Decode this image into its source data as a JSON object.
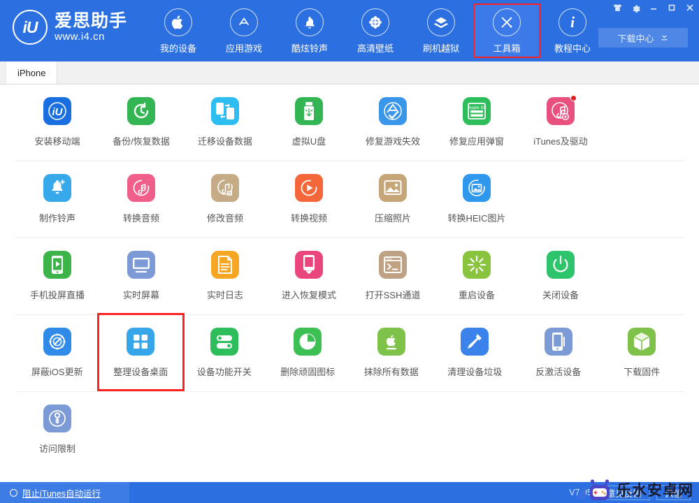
{
  "window": {
    "controls": [
      {
        "name": "skin-icon",
        "label": "换肤"
      },
      {
        "name": "settings-icon",
        "label": "设置"
      },
      {
        "name": "minimize-icon",
        "label": "最小化"
      },
      {
        "name": "maximize-icon",
        "label": "最大化"
      },
      {
        "name": "close-icon",
        "label": "关闭"
      }
    ]
  },
  "brand": {
    "logo_text": "iU",
    "name_cn": "爱思助手",
    "url": "www.i4.cn"
  },
  "header": {
    "nav": [
      {
        "label": "我的设备",
        "icon": "apple-icon",
        "active": false,
        "highlight": false
      },
      {
        "label": "应用游戏",
        "icon": "appstore-icon",
        "active": false,
        "highlight": false
      },
      {
        "label": "酷炫铃声",
        "icon": "bell-icon",
        "active": false,
        "highlight": false
      },
      {
        "label": "高清壁纸",
        "icon": "flower-icon",
        "active": false,
        "highlight": false
      },
      {
        "label": "刷机越狱",
        "icon": "box-icon",
        "active": false,
        "highlight": false
      },
      {
        "label": "工具箱",
        "icon": "tools-icon",
        "active": true,
        "highlight": true
      },
      {
        "label": "教程中心",
        "icon": "info-icon",
        "active": false,
        "highlight": false
      }
    ],
    "download_center": {
      "label": "下载中心",
      "icon": "download-icon"
    }
  },
  "tabs": [
    {
      "label": "iPhone",
      "active": true
    }
  ],
  "tools": {
    "rows": [
      [
        {
          "label": "安装移动端",
          "icon": "i4-app-icon",
          "color": "#1a6fe0",
          "badge": false
        },
        {
          "label": "备份/恢复数据",
          "icon": "backup-restore-icon",
          "color": "#34b554",
          "badge": false
        },
        {
          "label": "迁移设备数据",
          "icon": "migrate-data-icon",
          "color": "#2ebdf0",
          "badge": false
        },
        {
          "label": "虚拟U盘",
          "icon": "usb-drive-icon",
          "color": "#34b554",
          "badge": false
        },
        {
          "label": "修复游戏失效",
          "icon": "fix-game-icon",
          "color": "#3a96e8",
          "badge": false
        },
        {
          "label": "修复应用弹窗",
          "icon": "apple-id-icon",
          "color": "#2dbd5a",
          "badge": false
        },
        {
          "label": "iTunes及驱动",
          "icon": "itunes-driver-icon",
          "color": "#e8517e",
          "badge": true
        }
      ],
      [
        {
          "label": "制作铃声",
          "icon": "make-ringtone-icon",
          "color": "#37a8ea",
          "badge": false
        },
        {
          "label": "转换音频",
          "icon": "convert-audio-icon",
          "color": "#ef5f8a",
          "badge": false
        },
        {
          "label": "修改音频",
          "icon": "edit-audio-icon",
          "color": "#c6ab87",
          "badge": false
        },
        {
          "label": "转换视频",
          "icon": "convert-video-icon",
          "color": "#f4673a",
          "badge": false
        },
        {
          "label": "压缩照片",
          "icon": "compress-photo-icon",
          "color": "#c6a678",
          "badge": false
        },
        {
          "label": "转换HEIC图片",
          "icon": "heic-convert-icon",
          "color": "#2f97ec",
          "badge": false
        }
      ],
      [
        {
          "label": "手机投屏直播",
          "icon": "screen-cast-icon",
          "color": "#3cb44a",
          "badge": false
        },
        {
          "label": "实时屏幕",
          "icon": "live-screen-icon",
          "color": "#7b9ad6",
          "badge": false
        },
        {
          "label": "实时日志",
          "icon": "live-log-icon",
          "color": "#f5a623",
          "badge": false
        },
        {
          "label": "进入恢复模式",
          "icon": "recovery-mode-icon",
          "color": "#e8467c",
          "badge": false
        },
        {
          "label": "打开SSH通道",
          "icon": "ssh-tunnel-icon",
          "color": "#bfa183",
          "badge": false
        },
        {
          "label": "重启设备",
          "icon": "reboot-device-icon",
          "color": "#8ac43f",
          "badge": false
        },
        {
          "label": "关闭设备",
          "icon": "shutdown-device-icon",
          "color": "#2ec46b",
          "badge": false
        }
      ],
      [
        {
          "label": "屏蔽iOS更新",
          "icon": "block-ios-update-icon",
          "color": "#2f8ae8",
          "badge": false
        },
        {
          "label": "整理设备桌面",
          "icon": "organize-desktop-icon",
          "color": "#36a5ea",
          "badge": false,
          "highlight": true
        },
        {
          "label": "设备功能开关",
          "icon": "feature-toggle-icon",
          "color": "#2dbd5a",
          "badge": false
        },
        {
          "label": "删除顽固图标",
          "icon": "delete-icon-icon",
          "color": "#3cc054",
          "badge": false
        },
        {
          "label": "抹除所有数据",
          "icon": "erase-all-icon",
          "color": "#7fc24a",
          "badge": false
        },
        {
          "label": "清理设备垃圾",
          "icon": "clean-junk-icon",
          "color": "#3b82ea",
          "badge": false
        },
        {
          "label": "反激活设备",
          "icon": "deactivate-icon",
          "color": "#7b9ad6",
          "badge": false
        },
        {
          "label": "下载固件",
          "icon": "download-firmware-icon",
          "color": "#7fc24a",
          "badge": false
        }
      ],
      [
        {
          "label": "访问限制",
          "icon": "access-restriction-icon",
          "color": "#7b9ad6",
          "badge": false
        }
      ]
    ]
  },
  "status": {
    "block_itunes_label": "阻止iTunes自动运行",
    "version": "V7.95",
    "feedback_label": "意见反馈",
    "wechat_label": "微信"
  },
  "watermark": {
    "text": "乐水安卓网"
  },
  "colors": {
    "brand_blue": "#2b6fe0",
    "highlight_red": "#ff2020",
    "badge_red": "#e02020"
  }
}
